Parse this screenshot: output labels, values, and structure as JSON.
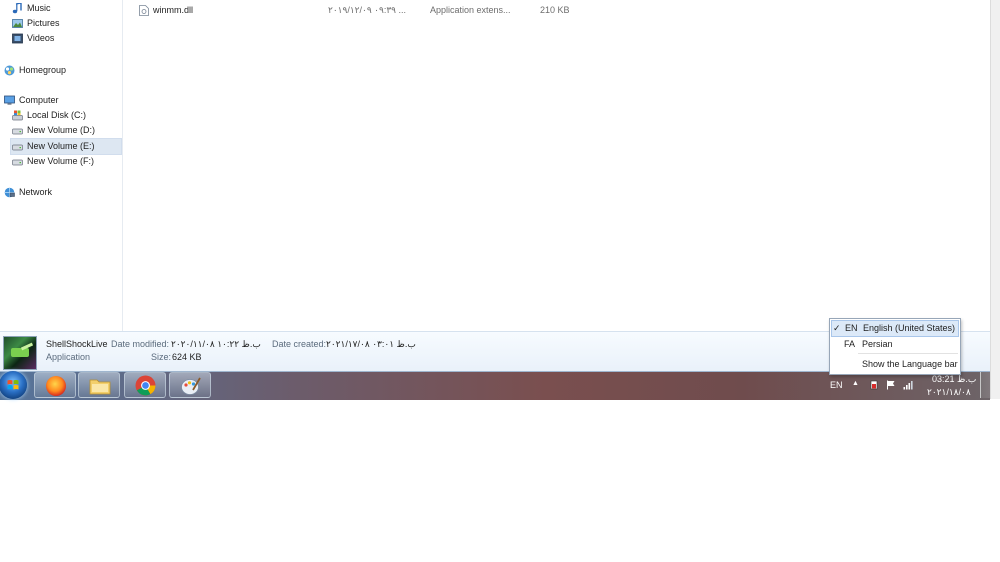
{
  "nav": {
    "items": [
      {
        "label": "Music",
        "icon": "music-icon",
        "name": "nav-item-music"
      },
      {
        "label": "Pictures",
        "icon": "pictures-icon",
        "name": "nav-item-pictures"
      },
      {
        "label": "Videos",
        "icon": "videos-icon",
        "name": "nav-item-videos"
      },
      {
        "label": "Homegroup",
        "icon": "homegroup-icon",
        "name": "nav-item-homegroup"
      },
      {
        "label": "Computer",
        "icon": "computer-icon",
        "name": "nav-item-computer"
      },
      {
        "label": "Local Disk (C:)",
        "icon": "system-drive-icon",
        "name": "nav-item-local-disk-c"
      },
      {
        "label": "New Volume (D:)",
        "icon": "drive-icon",
        "name": "nav-item-new-volume-d"
      },
      {
        "label": "New Volume (E:)",
        "icon": "drive-icon",
        "name": "nav-item-new-volume-e",
        "selected": true
      },
      {
        "label": "New Volume (F:)",
        "icon": "drive-icon",
        "name": "nav-item-new-volume-f"
      },
      {
        "label": "Network",
        "icon": "network-icon",
        "name": "nav-item-network"
      }
    ]
  },
  "files": [
    {
      "name": "winmm.dll",
      "date": "۲۰۱۹/۱۲/۰۹ ۰۹:۳۹ ...",
      "type": "Application extens...",
      "size": "210 KB",
      "icon": "dll-file-icon"
    }
  ],
  "details": {
    "name": "ShellShockLive",
    "type": "Application",
    "modified_label": "Date modified:",
    "modified_value": "۲۰۲۰/۱۱/۰۸ ب.ظ ۱۰:۲۲",
    "created_label": "Date created:",
    "created_value": "۲۰۲۱/۱۷/۰۸ ب.ظ ۰۳:۰۱",
    "size_label": "Size:",
    "size_value": "624 KB"
  },
  "taskbar": {
    "apps": [
      {
        "name": "firefox",
        "icon": "firefox-icon"
      },
      {
        "name": "file-explorer",
        "icon": "folder-icon"
      },
      {
        "name": "chrome",
        "icon": "chrome-icon"
      },
      {
        "name": "paint",
        "icon": "paint-icon"
      }
    ],
    "language_indicator": "EN",
    "clock_time": "03:21 ب.ظ",
    "clock_date": "۲۰۲۱/۱۸/۰۸"
  },
  "language_menu": {
    "items": [
      {
        "code": "EN",
        "label": "English (United States)",
        "checked": true,
        "check": "✓"
      },
      {
        "code": "FA",
        "label": "Persian",
        "checked": false,
        "check": ""
      }
    ],
    "show_bar_label": "Show the Language bar"
  },
  "colors": {
    "selection": "#dde7f2",
    "taskbar_start": "#55759c",
    "taskbar_mid": "#7a4f4f",
    "menu_highlight": "#dce9f8"
  }
}
